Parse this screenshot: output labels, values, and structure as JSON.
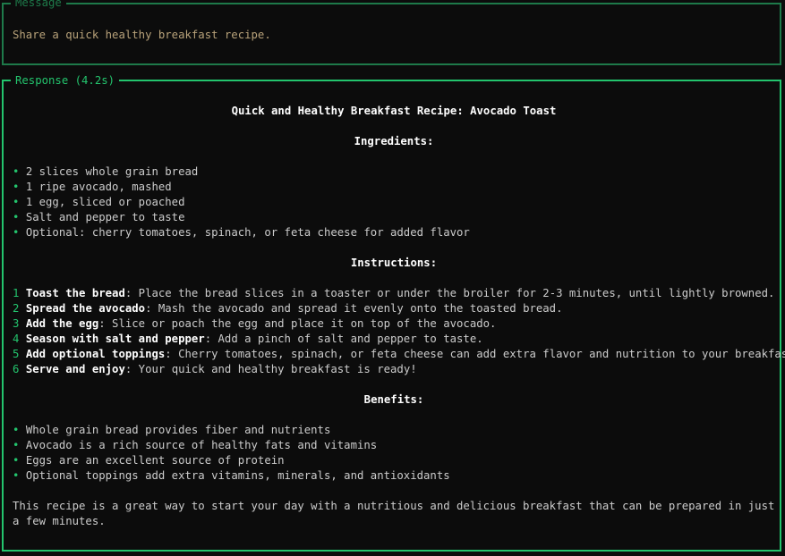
{
  "message_panel": {
    "title": "Message",
    "text": "Share a quick healthy breakfast recipe."
  },
  "response_panel": {
    "title": "Response (4.2s)",
    "heading": "Quick and Healthy Breakfast Recipe: Avocado Toast",
    "ingredients_heading": "Ingredients:",
    "bullet_glyph": "•",
    "ingredients": [
      "2 slices whole grain bread",
      "1 ripe avocado, mashed",
      "1 egg, sliced or poached",
      "Salt and pepper to taste",
      "Optional: cherry tomatoes, spinach, or feta cheese for added flavor"
    ],
    "instructions_heading": "Instructions:",
    "instructions": [
      {
        "num": "1",
        "label": "Toast the bread",
        "text": ": Place the bread slices in a toaster or under the broiler for 2-3 minutes, until lightly browned."
      },
      {
        "num": "2",
        "label": "Spread the avocado",
        "text": ": Mash the avocado and spread it evenly onto the toasted bread."
      },
      {
        "num": "3",
        "label": "Add the egg",
        "text": ": Slice or poach the egg and place it on top of the avocado."
      },
      {
        "num": "4",
        "label": "Season with salt and pepper",
        "text": ": Add a pinch of salt and pepper to taste."
      },
      {
        "num": "5",
        "label": "Add optional toppings",
        "text": ": Cherry tomatoes, spinach, or feta cheese can add extra flavor and nutrition to your breakfast."
      },
      {
        "num": "6",
        "label": "Serve and enjoy",
        "text": ": Your quick and healthy breakfast is ready!"
      }
    ],
    "benefits_heading": "Benefits:",
    "benefits": [
      "Whole grain bread provides fiber and nutrients",
      "Avocado is a rich source of healthy fats and vitamins",
      "Eggs are an excellent source of protein",
      "Optional toppings add extra vitamins, minerals, and antioxidants"
    ],
    "closing": "This recipe is a great way to start your day with a nutritious and delicious breakfast that can be prepared in just a few minutes."
  },
  "colors": {
    "accent": "#23c46d",
    "accent_dim": "#1e7a4a",
    "message_text": "#b8a27a",
    "body_text": "#cccccc",
    "background": "#0c0c0c"
  }
}
